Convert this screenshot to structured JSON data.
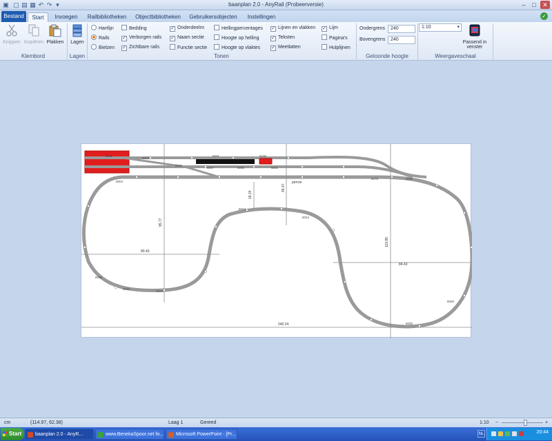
{
  "window": {
    "title": "baanplan 2.0 - AnyRail (Probeerversie)"
  },
  "tabs": [
    {
      "label": "Bestand"
    },
    {
      "label": "Start"
    },
    {
      "label": "Invoegen"
    },
    {
      "label": "Railbibliotheken"
    },
    {
      "label": "Objectbibliotheken"
    },
    {
      "label": "Gebruikersobjecten"
    },
    {
      "label": "Instellingen"
    }
  ],
  "ribbon": {
    "klembord": {
      "label": "Klembord",
      "cut": "Knippen",
      "copy": "Kopiëren",
      "paste": "Plakken"
    },
    "lagen": {
      "label": "Lagen",
      "button": "Lagen"
    },
    "view_radio": [
      {
        "label": "Hartlijn",
        "checked": false
      },
      {
        "label": "Rails",
        "checked": true
      },
      {
        "label": "Bielzen",
        "checked": false
      }
    ],
    "tonen_label": "Tonen",
    "tonen_col1": [
      {
        "label": "Bedding",
        "checked": false
      },
      {
        "label": "Verborgen rails",
        "checked": true
      },
      {
        "label": "Zichtbare rails",
        "checked": true
      }
    ],
    "tonen_col2": [
      {
        "label": "Onderdeelnr.",
        "checked": true
      },
      {
        "label": "Naam sectie",
        "checked": true
      },
      {
        "label": "Functie sectie",
        "checked": false
      }
    ],
    "tonen_col3": [
      {
        "label": "Hellingpercentages",
        "checked": false
      },
      {
        "label": "Hoogte op helling",
        "checked": false
      },
      {
        "label": "Hoogte op vlaktes",
        "checked": false
      }
    ],
    "tonen_col4": [
      {
        "label": "Lijnen en vlakken",
        "checked": true
      },
      {
        "label": "Teksten",
        "checked": true
      },
      {
        "label": "Meetlatten",
        "checked": true
      }
    ],
    "tonen_col5": [
      {
        "label": "Lijm",
        "checked": true
      },
      {
        "label": "Pagina's",
        "checked": false
      },
      {
        "label": "Hulplijnen",
        "checked": false
      }
    ],
    "hoogte": {
      "label": "Getoonde hoogte",
      "lower_label": "Ondergrens",
      "lower_value": "240",
      "upper_label": "Bovengrens",
      "upper_value": "240"
    },
    "schaal": {
      "label": "Weergaveschaal",
      "value": "1:10",
      "fit_line1": "Passend in",
      "fit_line2": "venster"
    }
  },
  "plan": {
    "dims": {
      "width_total": "240.24",
      "left_inner": "80.43",
      "right_inner": "84.43",
      "height_left": "95.77",
      "height_right": "119.85",
      "center_gap": "18.24",
      "center_gap2": "49.47"
    },
    "codes": [
      "6021",
      "6003",
      "6001",
      "6006",
      "6005",
      "6004",
      "6024",
      "6023",
      "6022",
      "6030",
      "6078",
      "6038",
      "6025",
      "6026",
      "6106",
      "6001",
      "6027"
    ],
    "text_perron": "perron",
    "text_small": "6024"
  },
  "statusbar": {
    "unit": "cm",
    "coords": "(114.97, 62.38)",
    "layer": "Laag 1",
    "status": "Gereed",
    "zoom": "1:10"
  },
  "taskbar": {
    "start": "Start",
    "tasks": [
      {
        "label": "baanplan 2.0 - AnyR...",
        "color": "#d04a2a"
      },
      {
        "label": "www.BenekaSpoor.net fo...",
        "color": "#3aa43a"
      },
      {
        "label": "Microsoft PowerPoint - [Pr...",
        "color": "#d35f2a"
      }
    ],
    "lang": "NL",
    "clock": "20:44"
  }
}
